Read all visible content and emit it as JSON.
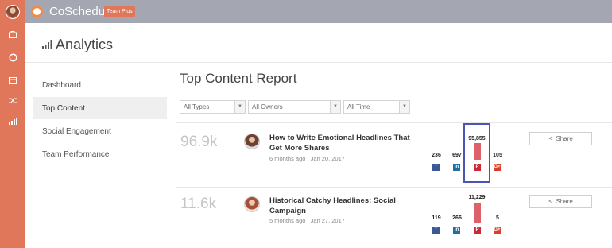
{
  "app": {
    "brand": "CoSchedule",
    "plan_badge": "Team Plus"
  },
  "page": {
    "title": "Analytics"
  },
  "sidebar": {
    "items": [
      {
        "label": "Dashboard",
        "active": false
      },
      {
        "label": "Top Content",
        "active": true
      },
      {
        "label": "Social Engagement",
        "active": false
      },
      {
        "label": "Team Performance",
        "active": false
      }
    ]
  },
  "report": {
    "title": "Top Content Report",
    "filters": [
      {
        "value": "All Types"
      },
      {
        "value": "All Owners"
      },
      {
        "value": "All Time"
      }
    ],
    "share_label": "Share",
    "rows": [
      {
        "total": "96.9k",
        "title": "How to Write Emotional Headlines That Get More Shares",
        "meta": "6 months ago | Jan 20, 2017",
        "facebook": "236",
        "linkedin": "697",
        "pinterest": "95,855",
        "googleplus": "105"
      },
      {
        "total": "11.6k",
        "title": "Historical Catchy Headlines: Social Campaign",
        "meta": "5 months ago | Jan 27, 2017",
        "facebook": "119",
        "linkedin": "266",
        "pinterest": "11,229",
        "googleplus": "5"
      }
    ]
  },
  "icons": {
    "facebook": "f",
    "linkedin": "in",
    "pinterest": "P",
    "googleplus": "G+"
  },
  "colors": {
    "accent": "#e0765a",
    "topbar": "#a4a7b1",
    "pinterest_bar": "#dc6169",
    "highlight": "#4a55b5"
  }
}
